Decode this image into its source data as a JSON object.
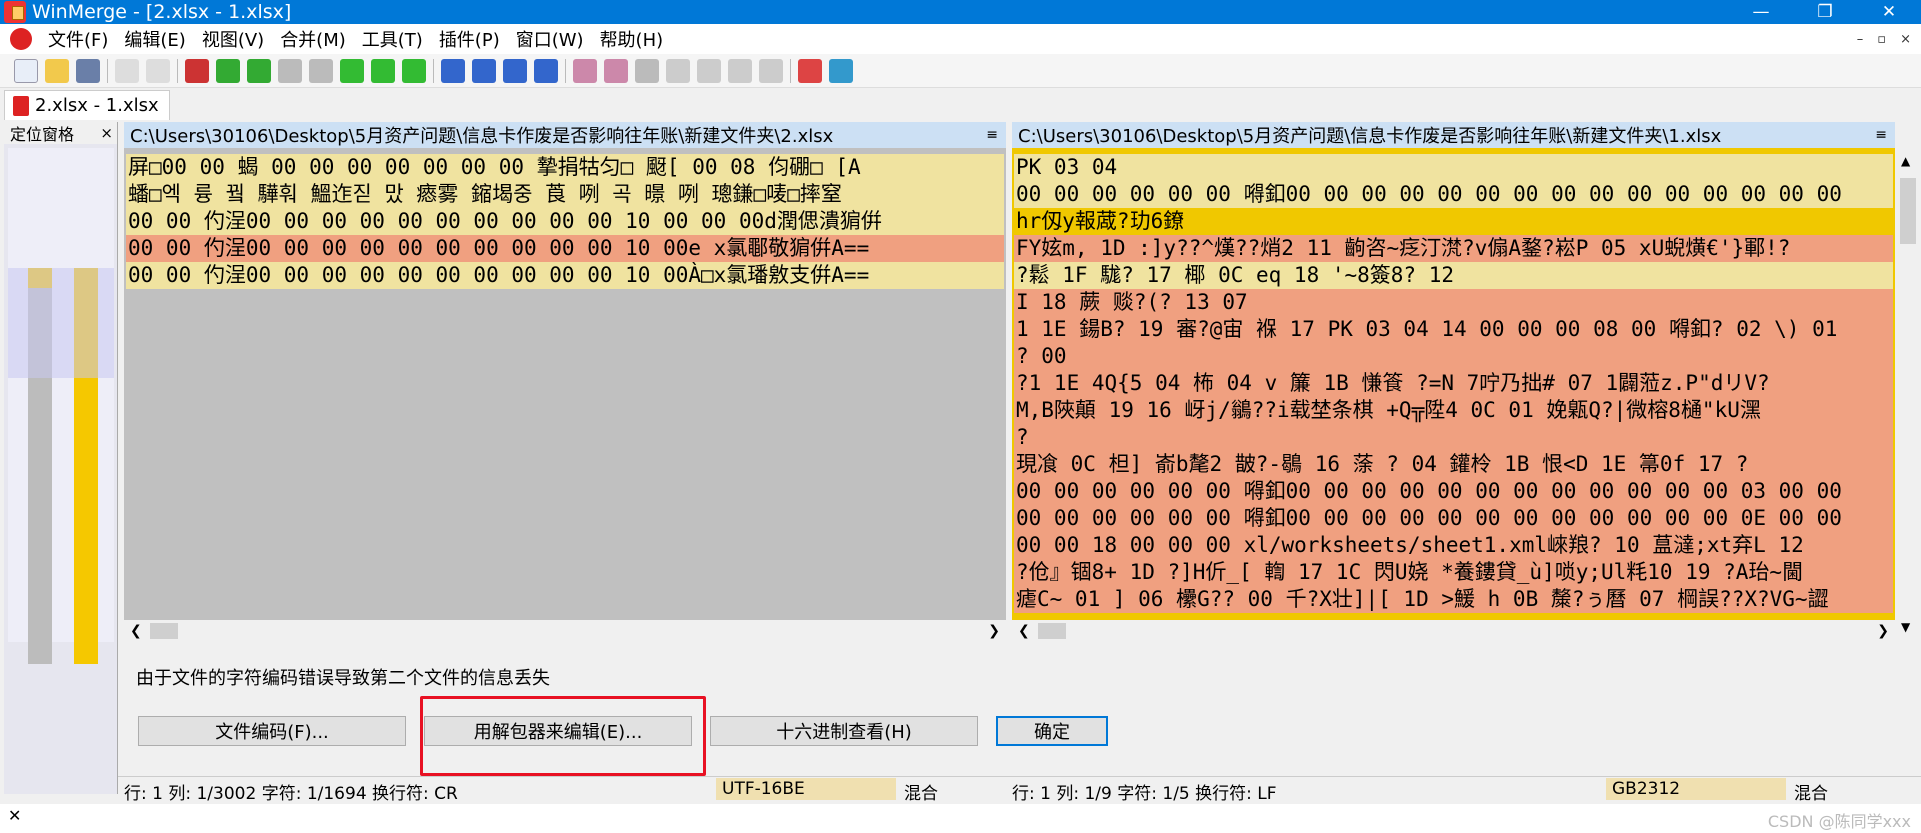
{
  "window": {
    "title": "WinMerge - [2.xlsx - 1.xlsx]",
    "controls": [
      "—",
      "❐",
      "✕"
    ]
  },
  "menu": {
    "items": [
      "文件(F)",
      "编辑(E)",
      "视图(V)",
      "合并(M)",
      "工具(T)",
      "插件(P)",
      "窗口(W)",
      "帮助(H)"
    ],
    "mdi_controls": [
      "–",
      "▫",
      "×"
    ]
  },
  "doc_tab": {
    "label": "2.xlsx - 1.xlsx"
  },
  "location_pane": {
    "title": "定位窗格",
    "close": "×"
  },
  "left_pane": {
    "path": "C:\\Users\\30106\\Desktop\\5月资产问题\\信息卡作废是否影响往年账\\新建文件夹\\2.xlsx",
    "rows": [
      {
        "kind": "y",
        "text": "屏□00 00 蝎   00 00 00 00 00 00 00 摯捐牯匀□ 颬[ 00 08  伨硼□ [A"
      },
      {
        "kind": "y",
        "text": "蟠□엑 륭 꿬 驊훠 鰮迮짇 맜 瘱雾 鏥堨중 莨  咧  곡  暻  咧  璁鎌□唛□摔窒"
      },
      {
        "kind": "y",
        "text": "00 00  仢浧00 00 00 00 00 00   00 00 00 00 10 00 00 00d潤偲潰猏倂"
      },
      {
        "kind": "o",
        "text": "00 00  仢浧00 00 00 00 00 00   00 00 00 00 10 00e x氯鄳敬猏倂A=="
      },
      {
        "kind": "y",
        "text": "00 00  仢浧00 00 00 00 00 00   00 00 00 00 10 00À□x氯璠敫支倂A=="
      }
    ]
  },
  "right_pane": {
    "path": "C:\\Users\\30106\\Desktop\\5月资产问题\\信息卡作废是否影响往年账\\新建文件夹\\1.xlsx",
    "rows": [
      {
        "kind": "y",
        "text": "PK 03 04"
      },
      {
        "kind": "y",
        "text": "00 00 00 00 00 00 嘚釦00 00 00 00 00 00 00 00 00 00 00 00 00  00 00"
      },
      {
        "kind": "gold",
        "text": "hr仭y報蒧?玏6鐐"
      },
      {
        "kind": "o",
        "text": "FY妶m, 1D :]y??^熯??焇2 11 齣咨~疺汀滼?v傓A鍪?崧P 05 xU蜺熿€'}鄆!?"
      },
      {
        "kind": "y",
        "text": "?鬆  1F 駹? 17 椰 0C eq 18 '~8簽8? 12"
      },
      {
        "kind": "o",
        "text": "I 18 蕨  赕?(?   13 07"
      },
      {
        "kind": "o",
        "text": "1 1E 鍚B? 19 審?@宙  褓 17 PK 03 04 14 00 00 00 08 00 嘚釦? 02 \\) 01"
      },
      {
        "kind": "o",
        "text": "? 00"
      },
      {
        "kind": "o",
        "text": "?1 1E 4Q{5 04 柨 04 v  簾 1B 慊篒  ?=N  7咛乃拙# 07 1闢蒞z.P\"dリV?"
      },
      {
        "kind": "o",
        "text": "M,B陜顛 19 16 岈j/鶲??i载埜条棋  +Q╦陞4 0C 01 娩甈Q?|微榕8樋\"kU潶"
      },
      {
        "kind": "o",
        "text": "?"
      },
      {
        "kind": "o",
        "text": "現飡 0C     柦]  嵛b氂2  皵?-鶡 16 蒤  ? 04 鑵柃 1B 恨<D 1E 箒0f 17 ?"
      },
      {
        "kind": "o",
        "text": "00 00 00 00 00 00 嘚釦00 00 00 00 00 00 00 00 00 00 00 00 03 00 00"
      },
      {
        "kind": "o",
        "text": "00 00 00 00 00 00 嘚釦00 00 00 00 00 00 00 00 00 00 00 00 0E 00 00"
      },
      {
        "kind": "o",
        "text": "00 00 18 00 00 00 xl/worksheets/sheet1.xml崍羪? 10 蒀澾;xt弃L 12"
      },
      {
        "kind": "o",
        "text": "?伧』锢8+ 1D ?]H伒_[ 輷 17 1C 閃U娆  *養鏤貸_ù]唢y;Ul粍10 19 ?A珆~閫"
      },
      {
        "kind": "o",
        "text": "瘧C~ 01 ] 06 欙G?? 00 千?X壮]|[ 1D >鰀   h 0B 斄?ぅ曆 07 棡誤??X?VG~譅"
      }
    ]
  },
  "message": "由于文件的字符编码错误导致第二个文件的信息丢失",
  "buttons": {
    "encoding": "文件编码(F)...",
    "unpacker": "用解包器来编辑(E)...",
    "hex": "十六进制查看(H)",
    "ok": "确定"
  },
  "status_left": {
    "position": "行: 1  列: 1/3002  字符: 1/1694  换行符: CR",
    "encoding": "UTF-16BE",
    "mode": "混合"
  },
  "status_right": {
    "position": "行: 1  列: 1/9  字符: 1/5  换行符: LF",
    "encoding": "GB2312",
    "mode": "混合"
  },
  "watermark": "CSDN @陈同学xxx",
  "colors": {
    "titlebar": "#0078d7",
    "diff_yellow": "#f0e3a0",
    "diff_orange": "#f0a080",
    "diff_gold": "#f0c800",
    "highlight_box": "#e81123"
  }
}
